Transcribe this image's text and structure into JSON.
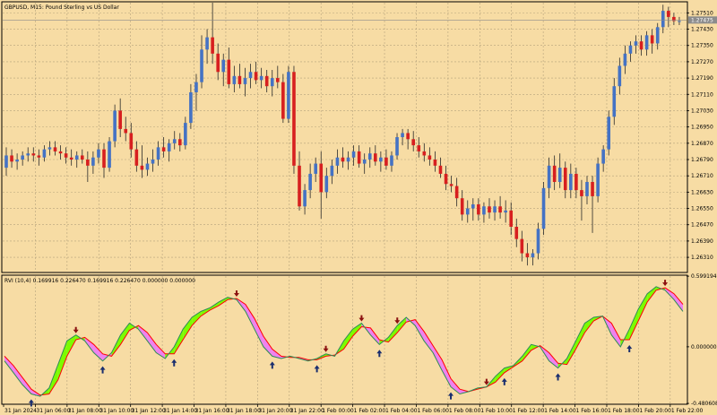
{
  "chart_data": [
    {
      "type": "candlestick",
      "title": "GBPUSD, M15:  Pound Sterling vs US Dollar",
      "ylim": [
        1.2624,
        1.2756
      ],
      "y_ticks": [
        "1.27510",
        "1.27430",
        "1.27350",
        "1.27270",
        "1.27190",
        "1.27110",
        "1.27030",
        "1.26950",
        "1.26870",
        "1.26790",
        "1.26710",
        "1.26630",
        "1.26550",
        "1.26470",
        "1.26390",
        "1.26310"
      ],
      "current_price": "1.27475",
      "colors": {
        "bull": "#4472c4",
        "bear": "#d71f1f",
        "wick": "#2a2a2a"
      },
      "ohlc": [
        [
          1.2675,
          1.2685,
          1.2671,
          1.2681
        ],
        [
          1.2681,
          1.2684,
          1.2675,
          1.2678
        ],
        [
          1.2678,
          1.2682,
          1.2674,
          1.2679
        ],
        [
          1.2679,
          1.2683,
          1.2676,
          1.2681
        ],
        [
          1.2681,
          1.2685,
          1.2678,
          1.2682
        ],
        [
          1.2682,
          1.2685,
          1.2678,
          1.2681
        ],
        [
          1.2681,
          1.2684,
          1.2676,
          1.268
        ],
        [
          1.268,
          1.2686,
          1.2678,
          1.2684
        ],
        [
          1.2684,
          1.2688,
          1.2681,
          1.2685
        ],
        [
          1.2685,
          1.2688,
          1.2681,
          1.2683
        ],
        [
          1.2683,
          1.2686,
          1.2679,
          1.2682
        ],
        [
          1.2682,
          1.2685,
          1.2677,
          1.268
        ],
        [
          1.268,
          1.2684,
          1.2676,
          1.2679
        ],
        [
          1.2679,
          1.2683,
          1.2675,
          1.2681
        ],
        [
          1.2681,
          1.2684,
          1.2677,
          1.2679
        ],
        [
          1.2679,
          1.2683,
          1.2668,
          1.2676
        ],
        [
          1.2676,
          1.2683,
          1.2672,
          1.268
        ],
        [
          1.268,
          1.2687,
          1.2677,
          1.2684
        ],
        [
          1.2684,
          1.2687,
          1.267,
          1.2675
        ],
        [
          1.2675,
          1.269,
          1.2673,
          1.2688
        ],
        [
          1.2688,
          1.2706,
          1.2685,
          1.2703
        ],
        [
          1.2703,
          1.2709,
          1.269,
          1.2694
        ],
        [
          1.2694,
          1.27,
          1.2688,
          1.2692
        ],
        [
          1.2692,
          1.2697,
          1.268,
          1.2684
        ],
        [
          1.2684,
          1.2688,
          1.2673,
          1.2676
        ],
        [
          1.2676,
          1.2686,
          1.267,
          1.2674
        ],
        [
          1.2674,
          1.268,
          1.2671,
          1.2677
        ],
        [
          1.2677,
          1.2684,
          1.2673,
          1.2679
        ],
        [
          1.2679,
          1.2688,
          1.2676,
          1.2685
        ],
        [
          1.2685,
          1.269,
          1.268,
          1.2683
        ],
        [
          1.2683,
          1.2689,
          1.2678,
          1.2687
        ],
        [
          1.2687,
          1.2693,
          1.2684,
          1.2689
        ],
        [
          1.2689,
          1.2692,
          1.2683,
          1.2686
        ],
        [
          1.2686,
          1.27,
          1.2684,
          1.2697
        ],
        [
          1.2697,
          1.2716,
          1.2694,
          1.2712
        ],
        [
          1.2712,
          1.2721,
          1.2703,
          1.2717
        ],
        [
          1.2717,
          1.274,
          1.2714,
          1.2733
        ],
        [
          1.2733,
          1.2743,
          1.2726,
          1.2739
        ],
        [
          1.2739,
          1.2756,
          1.2726,
          1.2731
        ],
        [
          1.2731,
          1.2736,
          1.2718,
          1.2722
        ],
        [
          1.2722,
          1.2731,
          1.2715,
          1.2728
        ],
        [
          1.2728,
          1.2734,
          1.2714,
          1.2716
        ],
        [
          1.2716,
          1.2725,
          1.2712,
          1.272
        ],
        [
          1.272,
          1.2726,
          1.2714,
          1.2716
        ],
        [
          1.2716,
          1.2724,
          1.271,
          1.2719
        ],
        [
          1.2719,
          1.2726,
          1.2714,
          1.2722
        ],
        [
          1.2722,
          1.2727,
          1.2716,
          1.2718
        ],
        [
          1.2718,
          1.2724,
          1.2714,
          1.272
        ],
        [
          1.272,
          1.2723,
          1.2712,
          1.2715
        ],
        [
          1.2715,
          1.2723,
          1.271,
          1.2719
        ],
        [
          1.2719,
          1.2725,
          1.2714,
          1.2717
        ],
        [
          1.2717,
          1.2721,
          1.2697,
          1.2699
        ],
        [
          1.2699,
          1.2725,
          1.2697,
          1.2722
        ],
        [
          1.2722,
          1.2725,
          1.2672,
          1.2676
        ],
        [
          1.2676,
          1.2683,
          1.2654,
          1.2656
        ],
        [
          1.2656,
          1.2667,
          1.2652,
          1.2664
        ],
        [
          1.2664,
          1.2677,
          1.266,
          1.2672
        ],
        [
          1.2672,
          1.268,
          1.2668,
          1.2677
        ],
        [
          1.2677,
          1.2683,
          1.265,
          1.2663
        ],
        [
          1.2663,
          1.2675,
          1.266,
          1.2671
        ],
        [
          1.2671,
          1.2679,
          1.2667,
          1.2676
        ],
        [
          1.2676,
          1.2684,
          1.2672,
          1.268
        ],
        [
          1.268,
          1.2685,
          1.2675,
          1.2678
        ],
        [
          1.2678,
          1.2683,
          1.2674,
          1.268
        ],
        [
          1.268,
          1.2686,
          1.2676,
          1.2683
        ],
        [
          1.2683,
          1.2686,
          1.2675,
          1.2677
        ],
        [
          1.2677,
          1.2682,
          1.2672,
          1.2679
        ],
        [
          1.2679,
          1.2685,
          1.2675,
          1.2682
        ],
        [
          1.2682,
          1.2686,
          1.2676,
          1.2678
        ],
        [
          1.2678,
          1.2683,
          1.2673,
          1.268
        ],
        [
          1.268,
          1.2684,
          1.2674,
          1.2676
        ],
        [
          1.2676,
          1.2683,
          1.2673,
          1.2681
        ],
        [
          1.2681,
          1.2692,
          1.2679,
          1.269
        ],
        [
          1.269,
          1.2694,
          1.2686,
          1.2692
        ],
        [
          1.2692,
          1.2694,
          1.2684,
          1.2689
        ],
        [
          1.2689,
          1.2693,
          1.2683,
          1.2686
        ],
        [
          1.2686,
          1.269,
          1.268,
          1.2683
        ],
        [
          1.2683,
          1.2687,
          1.2678,
          1.2681
        ],
        [
          1.2681,
          1.2685,
          1.2676,
          1.2679
        ],
        [
          1.2679,
          1.2683,
          1.2673,
          1.2676
        ],
        [
          1.2676,
          1.268,
          1.267,
          1.2672
        ],
        [
          1.2672,
          1.2676,
          1.2664,
          1.2667
        ],
        [
          1.2667,
          1.2671,
          1.2663,
          1.2666
        ],
        [
          1.2666,
          1.267,
          1.2656,
          1.266
        ],
        [
          1.266,
          1.2664,
          1.2649,
          1.2652
        ],
        [
          1.2652,
          1.2659,
          1.2648,
          1.2655
        ],
        [
          1.2655,
          1.266,
          1.2649,
          1.2657
        ],
        [
          1.2657,
          1.266,
          1.2649,
          1.2652
        ],
        [
          1.2652,
          1.2658,
          1.2648,
          1.2656
        ],
        [
          1.2656,
          1.266,
          1.265,
          1.2653
        ],
        [
          1.2653,
          1.2659,
          1.2649,
          1.2656
        ],
        [
          1.2656,
          1.2661,
          1.265,
          1.2653
        ],
        [
          1.2653,
          1.2659,
          1.2648,
          1.2654
        ],
        [
          1.2654,
          1.2658,
          1.2642,
          1.2646
        ],
        [
          1.2646,
          1.265,
          1.2636,
          1.264
        ],
        [
          1.264,
          1.2644,
          1.2629,
          1.2633
        ],
        [
          1.2633,
          1.2638,
          1.2627,
          1.2631
        ],
        [
          1.2631,
          1.2635,
          1.2627,
          1.2633
        ],
        [
          1.2633,
          1.2648,
          1.263,
          1.2645
        ],
        [
          1.2645,
          1.2668,
          1.2642,
          1.2665
        ],
        [
          1.2665,
          1.268,
          1.266,
          1.2676
        ],
        [
          1.2676,
          1.2681,
          1.2664,
          1.2668
        ],
        [
          1.2668,
          1.2682,
          1.2665,
          1.2675
        ],
        [
          1.2675,
          1.2678,
          1.266,
          1.2664
        ],
        [
          1.2664,
          1.2677,
          1.266,
          1.2672
        ],
        [
          1.2672,
          1.2675,
          1.266,
          1.2664
        ],
        [
          1.2664,
          1.2669,
          1.2649,
          1.2661
        ],
        [
          1.2661,
          1.2671,
          1.2657,
          1.2668
        ],
        [
          1.2668,
          1.2671,
          1.2643,
          1.2661
        ],
        [
          1.2661,
          1.268,
          1.2658,
          1.2677
        ],
        [
          1.2677,
          1.2686,
          1.2673,
          1.2684
        ],
        [
          1.2684,
          1.2703,
          1.2681,
          1.27
        ],
        [
          1.27,
          1.2719,
          1.2696,
          1.2715
        ],
        [
          1.2715,
          1.2729,
          1.2711,
          1.2725
        ],
        [
          1.2725,
          1.2735,
          1.2721,
          1.2731
        ],
        [
          1.2731,
          1.2737,
          1.2727,
          1.2735
        ],
        [
          1.2735,
          1.274,
          1.2731,
          1.2737
        ],
        [
          1.2737,
          1.274,
          1.273,
          1.2733
        ],
        [
          1.2733,
          1.2742,
          1.273,
          1.274
        ],
        [
          1.274,
          1.2743,
          1.2731,
          1.2736
        ],
        [
          1.2736,
          1.2746,
          1.2733,
          1.2744
        ],
        [
          1.2744,
          1.2755,
          1.2741,
          1.2752
        ],
        [
          1.2752,
          1.2754,
          1.2744,
          1.2749
        ],
        [
          1.2749,
          1.2751,
          1.2745,
          1.2747
        ],
        [
          1.2747,
          1.2749,
          1.2745,
          1.2747
        ]
      ],
      "x_labels": [
        "31 Jan 2024",
        "31 Jan 06:00",
        "31 Jan 08:00",
        "31 Jan 10:00",
        "31 Jan 12:00",
        "31 Jan 14:00",
        "31 Jan 16:00",
        "31 Jan 18:00",
        "31 Jan 20:00",
        "31 Jan 22:00",
        "1 Feb 00:00",
        "1 Feb 02:00",
        "1 Feb 04:00",
        "1 Feb 06:00",
        "1 Feb 08:00",
        "1 Feb 10:00",
        "1 Feb 12:00",
        "1 Feb 14:00",
        "1 Feb 16:00",
        "1 Feb 18:00",
        "1 Feb 20:00",
        "1 Feb 22:00"
      ]
    },
    {
      "type": "area",
      "title": "RVI (10,4) 0.169916 0.226470 0.169916 0.226470 0.000000 0.000000",
      "ylim": [
        -0.48,
        0.6
      ],
      "y_ticks": [
        "0.599194",
        "0.000000",
        "-0.480608"
      ],
      "colors": {
        "up_fill": "#7cfc00",
        "down_fill": "#ee82ee",
        "signal_line": "#ff0000",
        "main_line": "#2e8b57",
        "arrow_up": "#1a2e6e",
        "arrow_down": "#8b1010"
      },
      "series": [
        {
          "values": [
            -0.12,
            -0.22,
            -0.32,
            -0.4,
            -0.42,
            -0.35,
            -0.15,
            0.05,
            0.1,
            0.05,
            -0.05,
            -0.12,
            -0.05,
            0.1,
            0.2,
            0.15,
            0.05,
            -0.05,
            -0.1,
            0.0,
            0.15,
            0.25,
            0.3,
            0.33,
            0.38,
            0.42,
            0.4,
            0.3,
            0.15,
            0.0,
            -0.08,
            -0.1,
            -0.08,
            -0.1,
            -0.12,
            -0.1,
            -0.06,
            -0.08,
            0.05,
            0.15,
            0.2,
            0.1,
            0.02,
            0.08,
            0.18,
            0.25,
            0.18,
            0.05,
            -0.05,
            -0.2,
            -0.34,
            -0.4,
            -0.38,
            -0.35,
            -0.34,
            -0.25,
            -0.18,
            -0.16,
            -0.08,
            0.02,
            0.0,
            -0.12,
            -0.18,
            -0.1,
            0.05,
            0.2,
            0.25,
            0.26,
            0.1,
            0.0,
            0.15,
            0.32,
            0.45,
            0.51,
            0.48,
            0.4,
            0.3
          ]
        },
        {
          "values": [
            -0.08,
            -0.16,
            -0.26,
            -0.36,
            -0.41,
            -0.4,
            -0.28,
            -0.08,
            0.06,
            0.08,
            0.02,
            -0.06,
            -0.08,
            0.02,
            0.14,
            0.18,
            0.12,
            0.02,
            -0.06,
            -0.06,
            0.06,
            0.18,
            0.26,
            0.31,
            0.35,
            0.4,
            0.41,
            0.36,
            0.24,
            0.09,
            -0.02,
            -0.08,
            -0.09,
            -0.09,
            -0.11,
            -0.11,
            -0.08,
            -0.07,
            -0.02,
            0.09,
            0.17,
            0.16,
            0.06,
            0.04,
            0.12,
            0.21,
            0.23,
            0.13,
            0.01,
            -0.11,
            -0.27,
            -0.36,
            -0.38,
            -0.36,
            -0.34,
            -0.3,
            -0.22,
            -0.17,
            -0.12,
            -0.03,
            0.01,
            -0.05,
            -0.14,
            -0.15,
            -0.02,
            0.12,
            0.22,
            0.26,
            0.2,
            0.06,
            0.06,
            0.22,
            0.38,
            0.48,
            0.5,
            0.45,
            0.36
          ]
        }
      ],
      "signals": {
        "up": [
          3,
          11,
          19,
          30,
          35,
          42,
          50,
          56,
          62,
          70
        ],
        "down": [
          8,
          26,
          36,
          40,
          44,
          54,
          74
        ]
      },
      "x_labels": [
        "31 Jan 2024",
        "31 Jan 06:00",
        "31 Jan 08:00",
        "31 Jan 10:00",
        "31 Jan 12:00",
        "31 Jan 14:00",
        "31 Jan 16:00",
        "31 Jan 18:00",
        "31 Jan 20:00",
        "31 Jan 22:00",
        "1 Feb 00:00",
        "1 Feb 02:00",
        "1 Feb 04:00",
        "1 Feb 06:00",
        "1 Feb 08:00",
        "1 Feb 10:00",
        "1 Feb 12:00",
        "1 Feb 14:00",
        "1 Feb 16:00",
        "1 Feb 18:00",
        "1 Feb 20:00",
        "1 Feb 22:00"
      ]
    }
  ]
}
